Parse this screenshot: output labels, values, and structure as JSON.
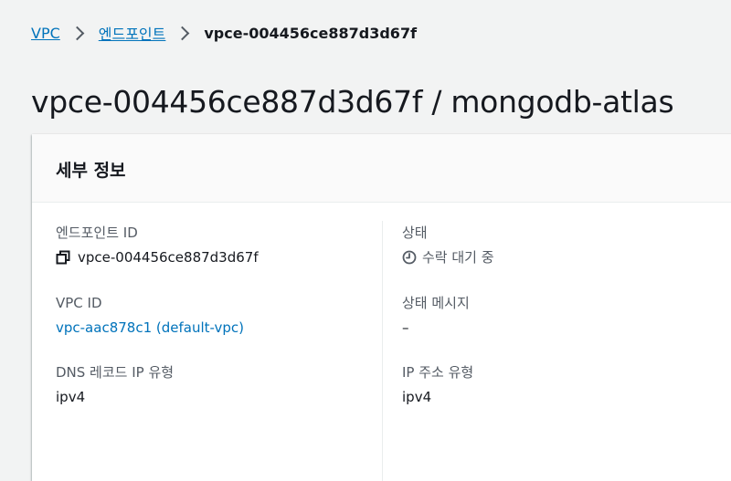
{
  "breadcrumb": {
    "items": [
      {
        "label": "VPC"
      },
      {
        "label": "엔드포인트"
      }
    ],
    "current": "vpce-004456ce887d3d67f"
  },
  "page": {
    "title": "vpce-004456ce887d3d67f / mongodb-atlas"
  },
  "details": {
    "header": "세부 정보",
    "left": {
      "endpoint_id": {
        "label": "엔드포인트 ID",
        "value": "vpce-004456ce887d3d67f",
        "icon": "copy-icon"
      },
      "vpc_id": {
        "label": "VPC ID",
        "value": "vpc-aac878c1 (default-vpc)"
      },
      "dns_record_ip_type": {
        "label": "DNS 레코드 IP 유형",
        "value": "ipv4"
      }
    },
    "right": {
      "status": {
        "label": "상태",
        "value": "수락 대기 중",
        "icon": "clock-icon"
      },
      "status_message": {
        "label": "상태 메시지",
        "value": "–"
      },
      "ip_address_type": {
        "label": "IP 주소 유형",
        "value": "ipv4"
      }
    }
  },
  "colors": {
    "link": "#0073bb",
    "background": "#f2f3f3",
    "text": "#16191f",
    "label": "#545b64"
  }
}
